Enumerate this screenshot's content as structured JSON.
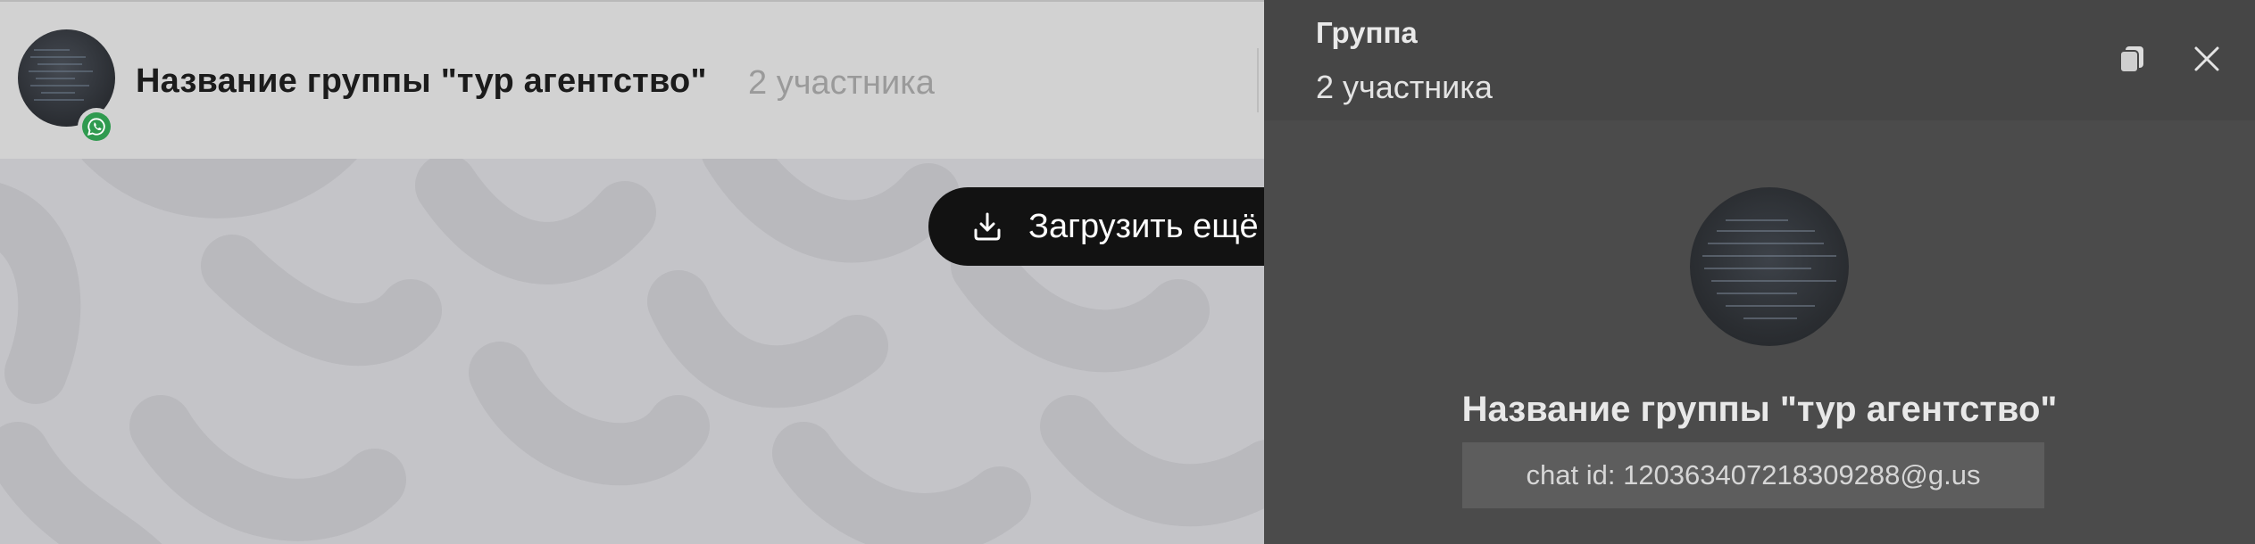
{
  "chat": {
    "title": "Название группы \"тур агентство\"",
    "participants": "2 участника",
    "load_more_label": "Загрузить ещё"
  },
  "panel": {
    "title": "Группа",
    "subtitle": "2 участника",
    "group_name": "Название группы \"тур агентство\"",
    "chat_id": "chat id: 120363407218309288@g.us"
  },
  "icons": {
    "messenger_badge": "whatsapp-icon",
    "load_more": "download-icon",
    "copy": "copy-icon",
    "close": "close-icon"
  },
  "colors": {
    "whatsapp_green": "#2f9a4f",
    "load_more_bg": "#121212",
    "panel_bg": "#4b4b4b"
  }
}
